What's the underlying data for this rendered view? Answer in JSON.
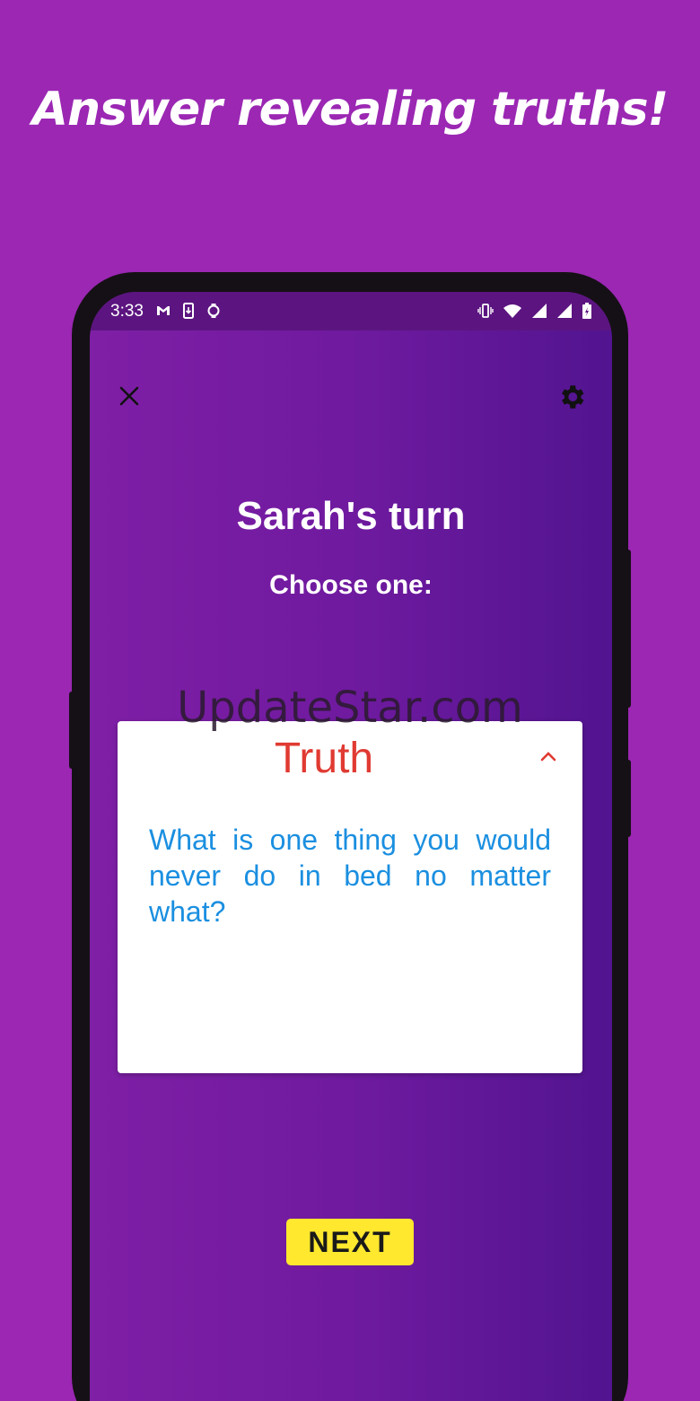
{
  "promo": {
    "title": "Answer revealing truths!"
  },
  "status_bar": {
    "time": "3:33",
    "left_icons": [
      "gmail-icon",
      "phone-download-icon",
      "watch-icon"
    ],
    "right_icons": [
      "vibrate-icon",
      "wifi-icon",
      "signal-icon",
      "signal-icon",
      "battery-charging-icon"
    ]
  },
  "game": {
    "turn_title": "Sarah's turn",
    "choose_label": "Choose one:",
    "card": {
      "title": "Truth",
      "question": "What is one thing you would never do in bed no matter what?"
    },
    "next_label": "NEXT"
  },
  "watermark": "UpdateStar.com",
  "colors": {
    "background": "#9b27b3",
    "card_title": "#e03a32",
    "question_text": "#1b8fe0",
    "next_button": "#ffe82e"
  }
}
